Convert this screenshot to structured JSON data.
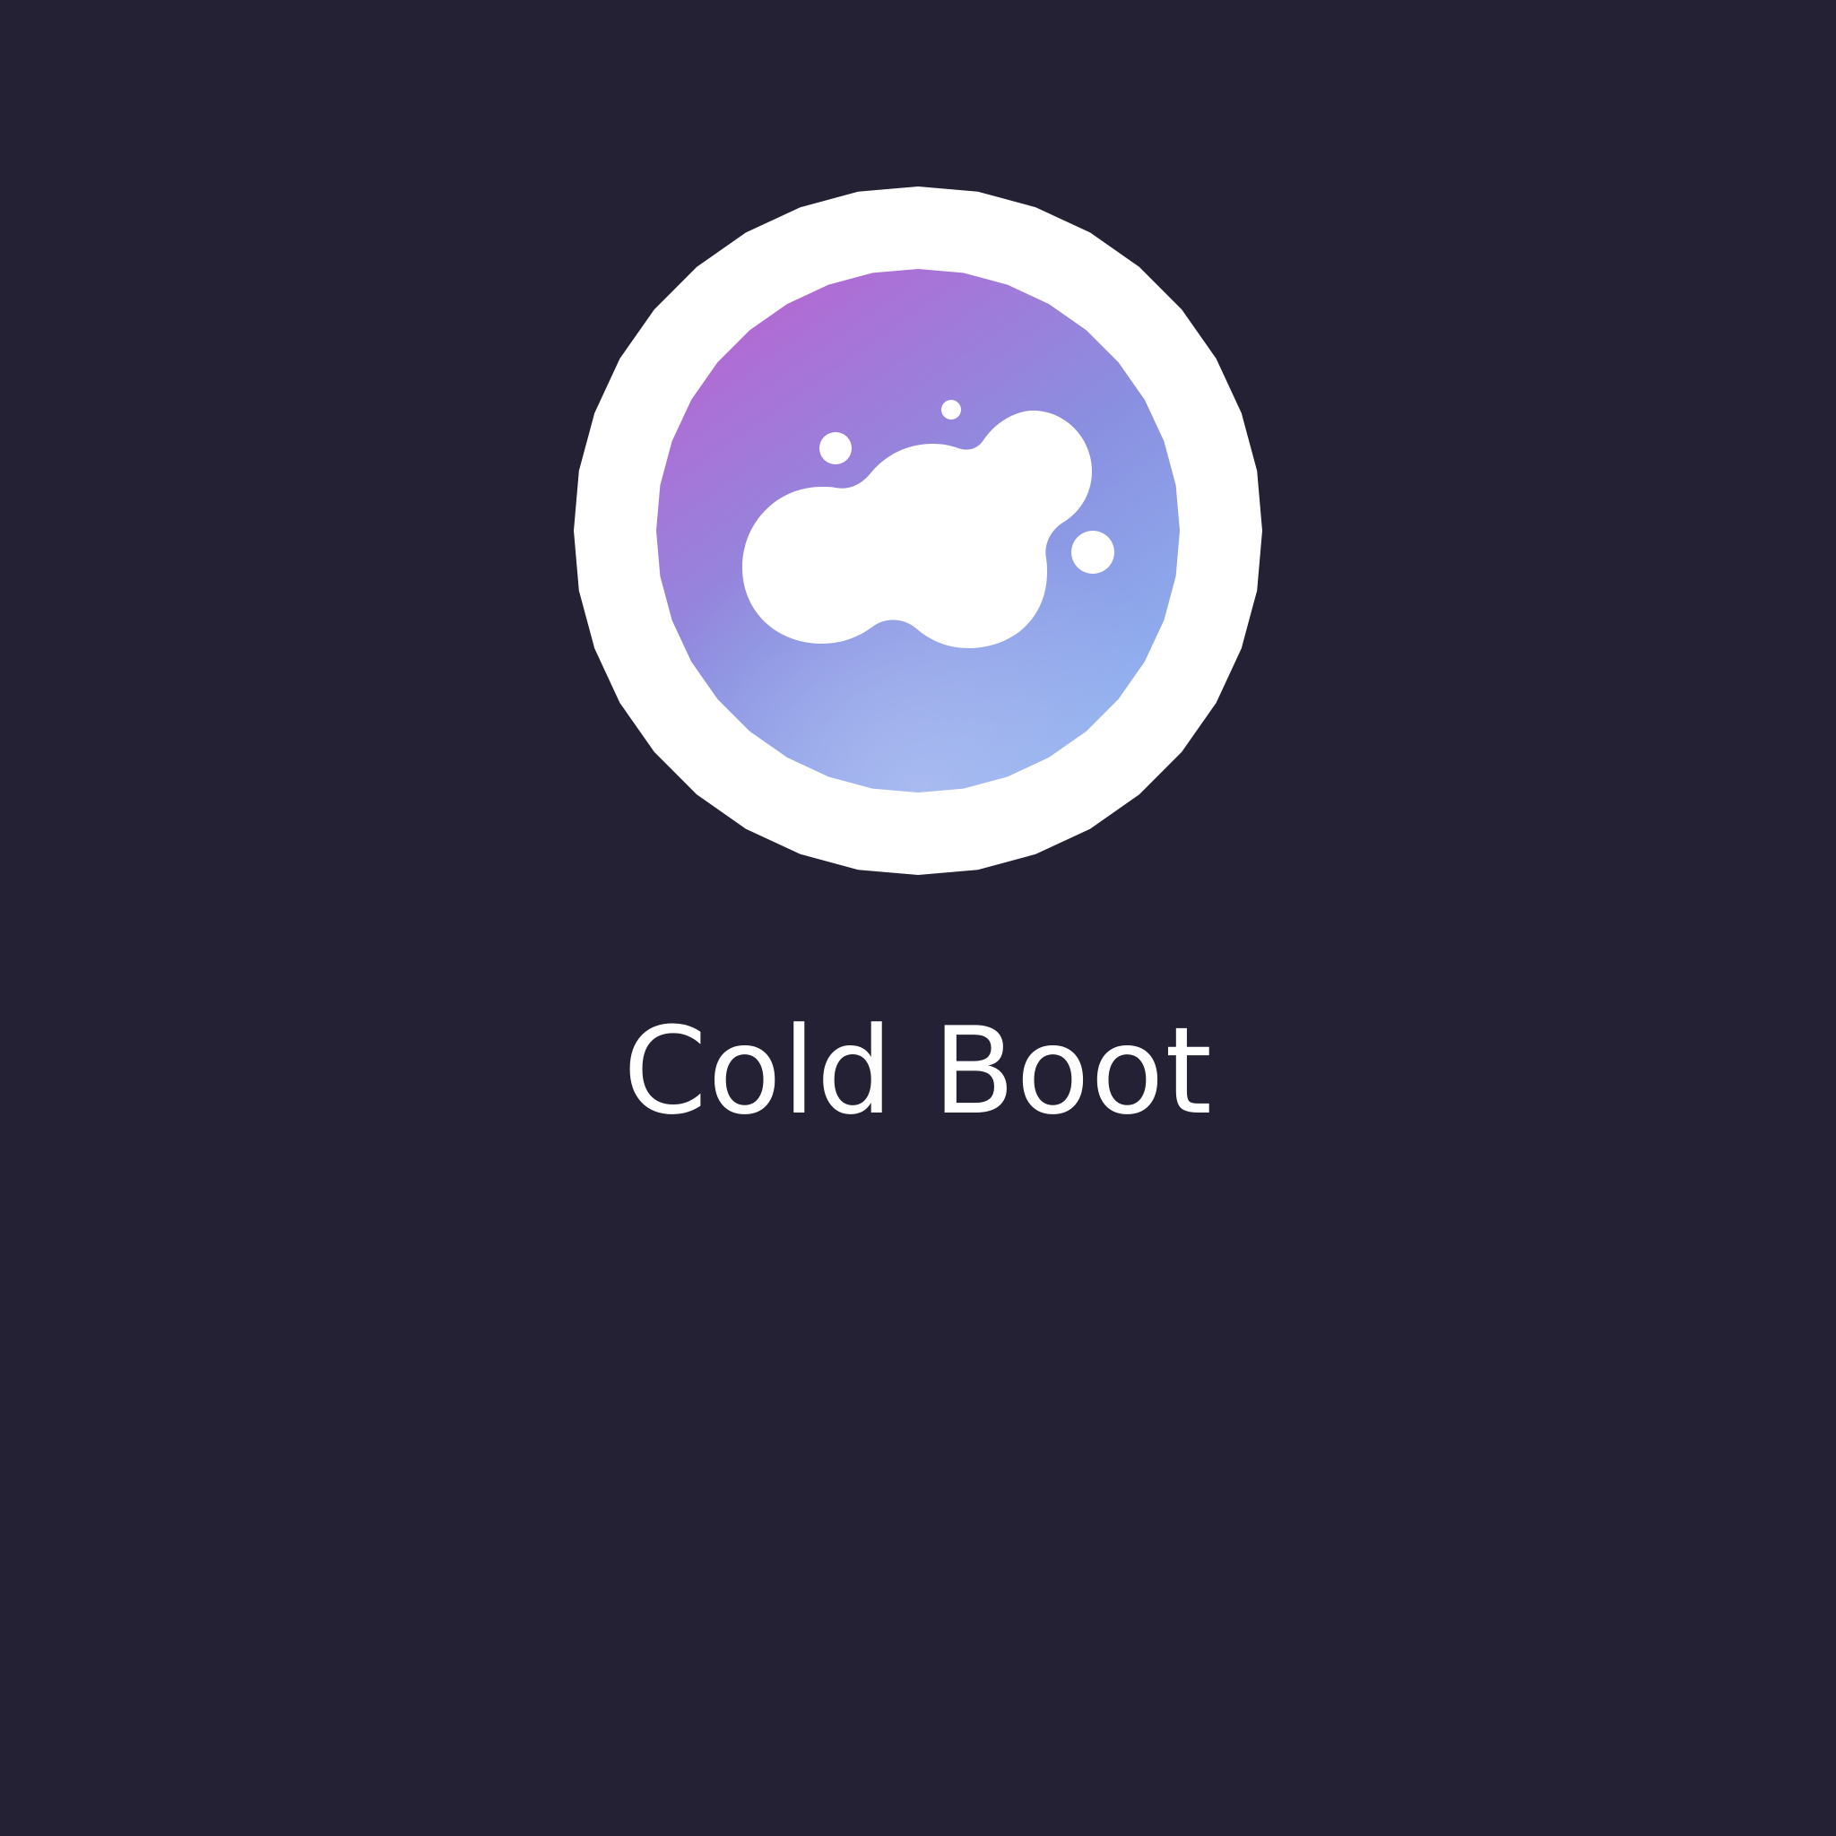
{
  "app": {
    "title": "Cold Boot",
    "logo_icon": "cloud-bubbles-icon"
  },
  "colors": {
    "background": "#242134",
    "ring": "#ffffff",
    "gradient_start": "#b06cd4",
    "gradient_mid": "#8a8fe0",
    "gradient_end": "#89b6f0",
    "title_text": "#ffffff"
  }
}
